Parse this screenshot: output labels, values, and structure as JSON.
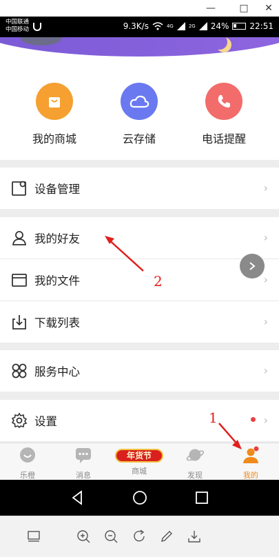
{
  "status_bar": {
    "carrier_1": "中国联通",
    "carrier_2": "中国移动",
    "speed": "9.3K/s",
    "network_1": "4G",
    "network_2": "2G",
    "battery": "24%",
    "time": "22:51"
  },
  "quick_actions": [
    {
      "label": "我的商城",
      "icon": "shopping-bag-icon",
      "color": "#f5a030"
    },
    {
      "label": "云存储",
      "icon": "cloud-icon",
      "color": "#6a79f0"
    },
    {
      "label": "电话提醒",
      "icon": "phone-icon",
      "color": "#f26c6c"
    }
  ],
  "menu": {
    "device_management": "设备管理",
    "my_friends": "我的好友",
    "my_files": "我的文件",
    "download_list": "下载列表",
    "service_center": "服务中心",
    "settings": "设置"
  },
  "tabs": [
    {
      "label": "乐橙",
      "icon": "lechange-icon"
    },
    {
      "label": "消息",
      "icon": "message-icon"
    },
    {
      "label": "商城",
      "icon": "mall-icon",
      "banner": "年货节"
    },
    {
      "label": "发现",
      "icon": "discover-icon"
    },
    {
      "label": "我的",
      "icon": "profile-icon",
      "active": true
    }
  ],
  "annotations": {
    "marker_1": "1",
    "marker_2": "2"
  },
  "colors": {
    "accent": "#f08a1a",
    "annotation": "#e0201e"
  }
}
